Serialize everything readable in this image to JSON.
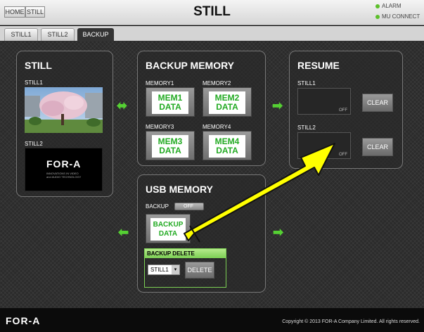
{
  "header": {
    "home_label": "HOME",
    "still_label": "STILL",
    "title": "STILL",
    "alarm_label": "ALARM",
    "mu_connect_label": "MU CONNECT"
  },
  "tabs": [
    {
      "label": "STILL1"
    },
    {
      "label": "STILL2"
    },
    {
      "label": "BACKUP"
    }
  ],
  "still_panel": {
    "title": "STILL",
    "still1_label": "STILL1",
    "still2_label": "STILL2",
    "logo_text": "FOR-A",
    "logo_sub1": "INNOVATIONS IN VIDEO",
    "logo_sub2": "and AUDIO TECHNOLOGY"
  },
  "backup_memory": {
    "title": "BACKUP MEMORY",
    "items": [
      {
        "label": "MEMORY1",
        "line1": "MEM1",
        "line2": "DATA"
      },
      {
        "label": "MEMORY2",
        "line1": "MEM2",
        "line2": "DATA"
      },
      {
        "label": "MEMORY3",
        "line1": "MEM3",
        "line2": "DATA"
      },
      {
        "label": "MEMORY4",
        "line1": "MEM4",
        "line2": "DATA"
      }
    ]
  },
  "resume": {
    "title": "RESUME",
    "still1_label": "STILL1",
    "still2_label": "STILL2",
    "off_label": "OFF",
    "clear_label": "CLEAR"
  },
  "usb_memory": {
    "title": "USB MEMORY",
    "backup_label": "BACKUP",
    "toggle_label": "OFF",
    "backup_data_line1": "BACKUP",
    "backup_data_line2": "DATA",
    "delete_title": "BACKUP DELETE",
    "select_value": "STILL1",
    "delete_label": "DELETE"
  },
  "footer": {
    "logo_text": "FOR-A",
    "copyright": "Copyright © 2013 FOR-A Company Limited. All rights reserved."
  },
  "colors": {
    "accent_green": "#55d033",
    "status_green": "#5cbf2a",
    "logo_red": "#e0302b",
    "annotation_yellow": "#ffff00"
  }
}
